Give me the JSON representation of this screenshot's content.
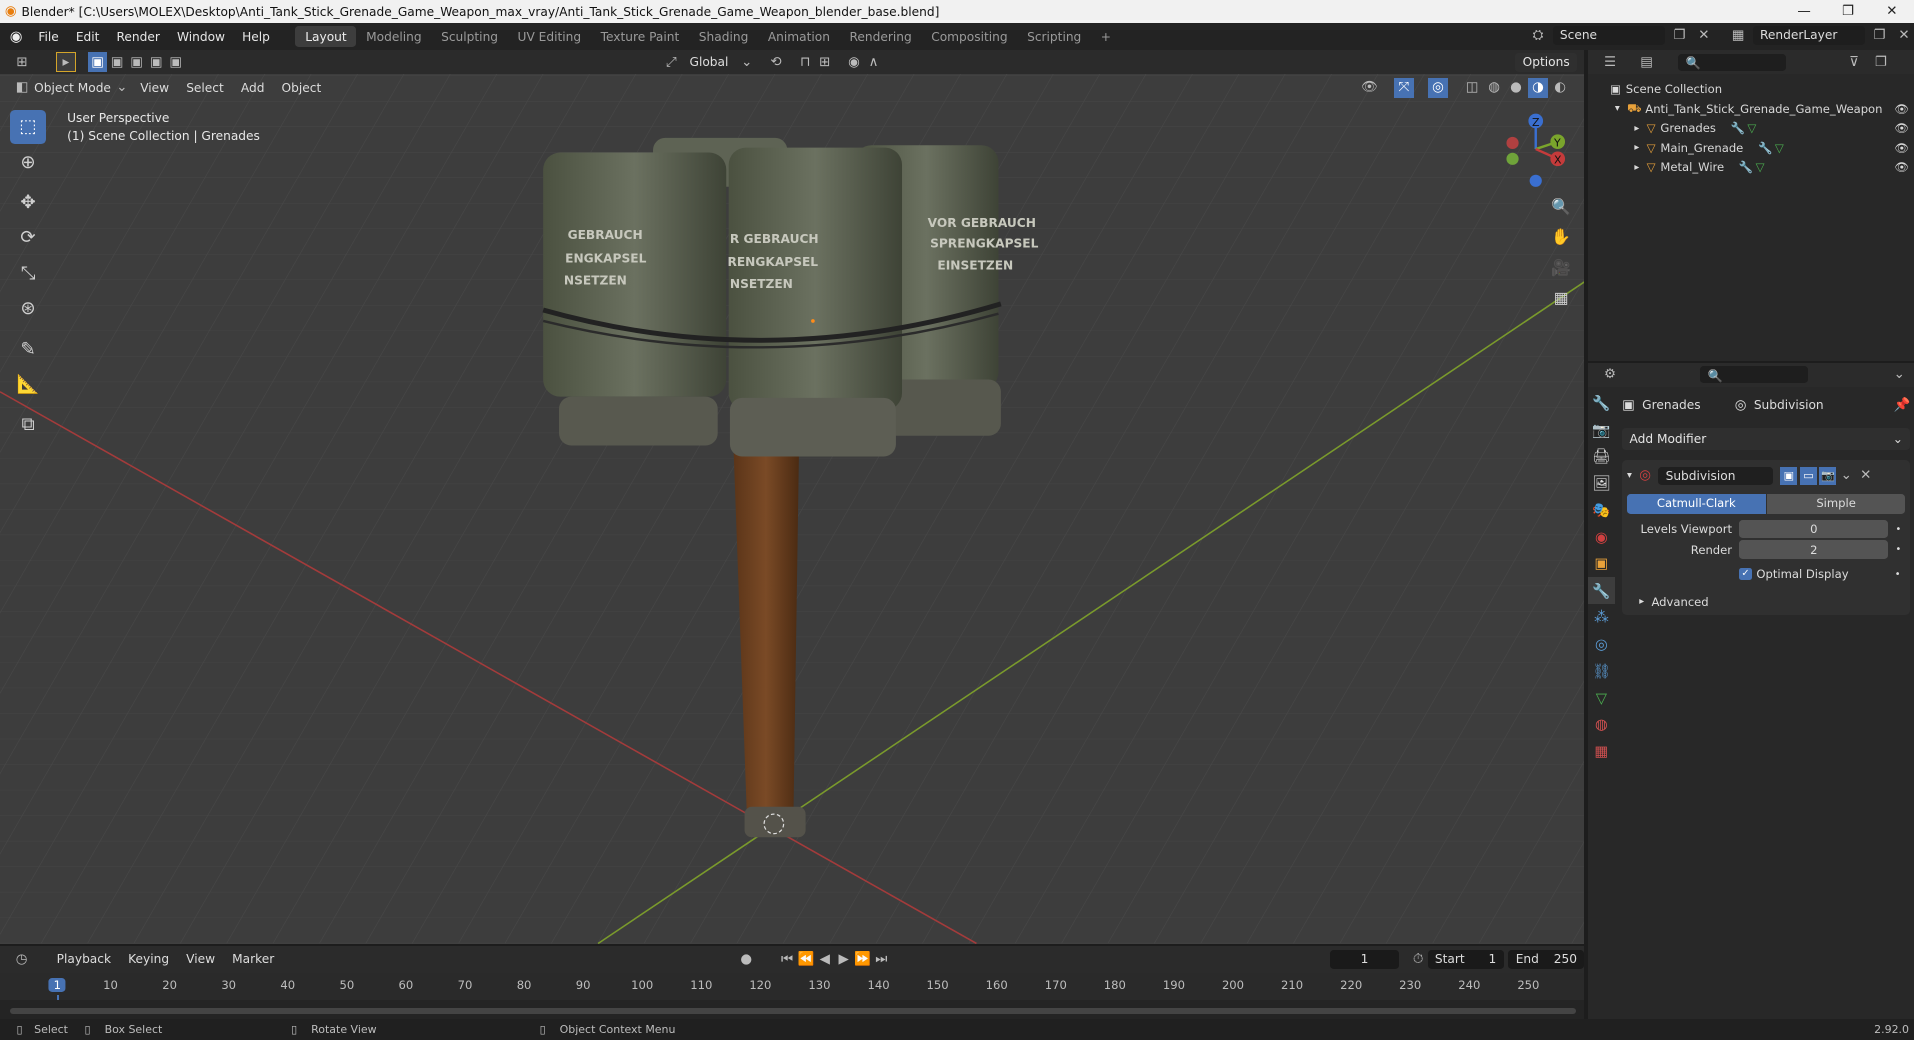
{
  "window": {
    "title": "Blender* [C:\\Users\\MOLEX\\Desktop\\Anti_Tank_Stick_Grenade_Game_Weapon_max_vray/Anti_Tank_Stick_Grenade_Game_Weapon_blender_base.blend]"
  },
  "menu": [
    "File",
    "Edit",
    "Render",
    "Window",
    "Help"
  ],
  "workspaces": [
    "Layout",
    "Modeling",
    "Sculpting",
    "UV Editing",
    "Texture Paint",
    "Shading",
    "Animation",
    "Rendering",
    "Compositing",
    "Scripting",
    "+"
  ],
  "scene": {
    "name": "Scene",
    "render_layer": "RenderLayer"
  },
  "viewport": {
    "orientation": "Global",
    "options_label": "Options",
    "mode": "Object Mode",
    "header_menus": [
      "View",
      "Select",
      "Add",
      "Object"
    ],
    "info_line1": "User Perspective",
    "info_line2": "(1) Scene Collection | Grenades",
    "gizmo": {
      "z": "Z",
      "y": "Y",
      "x": "X"
    },
    "stencils": {
      "left": [
        "GEBRAUCH",
        "ENGKAPSEL",
        "NSETZEN"
      ],
      "mid": [
        "R GEBRAUCH",
        "RENGKAPSEL",
        "NSETZEN"
      ],
      "right": [
        "VOR GEBRAUCH",
        "SPRENGKAPSEL",
        "EINSETZEN"
      ]
    }
  },
  "timeline": {
    "menus": [
      "Playback",
      "Keying",
      "View",
      "Marker"
    ],
    "current_frame": "1",
    "start_label": "Start",
    "start": "1",
    "end_label": "End",
    "end": "250",
    "ticks": [
      "1",
      "10",
      "20",
      "30",
      "40",
      "50",
      "60",
      "70",
      "80",
      "90",
      "100",
      "110",
      "120",
      "130",
      "140",
      "150",
      "160",
      "170",
      "180",
      "190",
      "200",
      "210",
      "220",
      "230",
      "240",
      "250"
    ]
  },
  "status": {
    "select": "Select",
    "box_select": "Box Select",
    "rotate": "Rotate View",
    "context": "Object Context Menu",
    "version": "2.92.0"
  },
  "outliner": {
    "root": "Scene Collection",
    "collection": "Anti_Tank_Stick_Grenade_Game_Weapon",
    "items": [
      "Grenades",
      "Main_Grenade",
      "Metal_Wire"
    ]
  },
  "properties": {
    "object": "Grenades",
    "modifier_crumb": "Subdivision",
    "add_modifier": "Add Modifier",
    "modifier_name": "Subdivision",
    "mode_a": "Catmull-Clark",
    "mode_b": "Simple",
    "levels_label": "Levels Viewport",
    "levels_value": "0",
    "render_label": "Render",
    "render_value": "2",
    "optimal_label": "Optimal Display",
    "optimal_checked": true,
    "advanced_label": "Advanced"
  },
  "colors": {
    "accent": "#4772b3",
    "x_axis": "#a33b3b",
    "y_axis": "#7a9a2c",
    "viewport_bg": "#3d3d3d"
  }
}
